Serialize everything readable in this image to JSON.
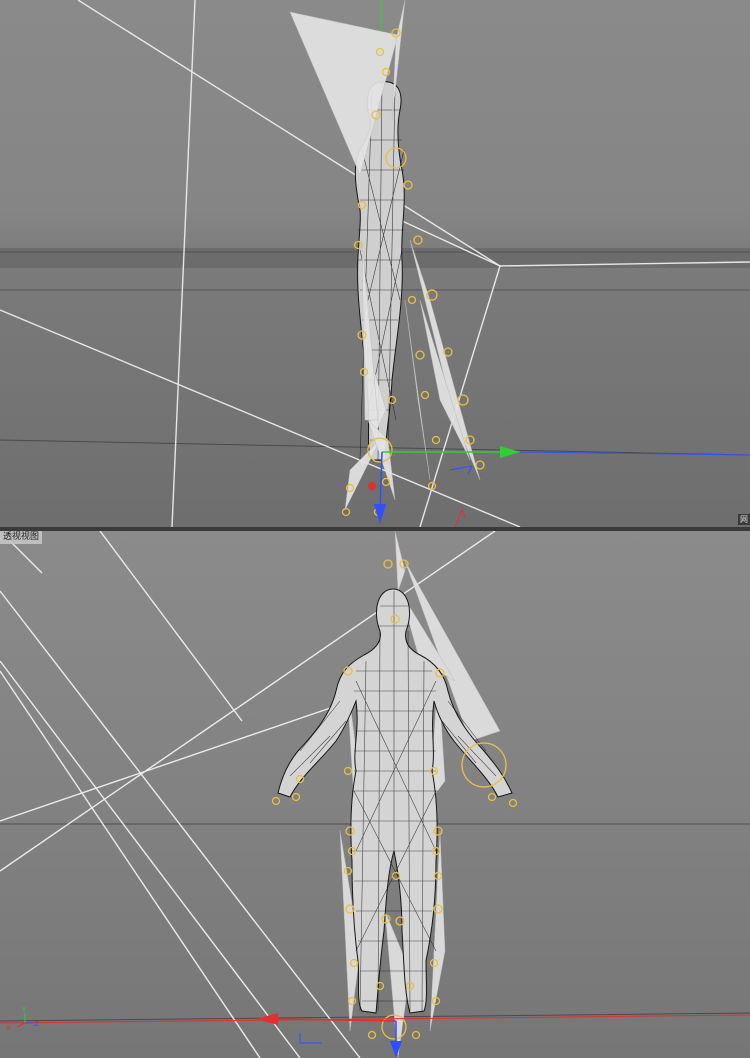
{
  "viewports": {
    "top": {
      "corner_tag": "网"
    },
    "bottom": {
      "label": "透视视图"
    }
  },
  "axis_labels": {
    "x": "X",
    "y": "Y",
    "z": "Z"
  },
  "colors": {
    "axis_x": "#e03030",
    "axis_y": "#30d030",
    "axis_z": "#3050ff",
    "joint": "#e8c040",
    "bone": "#d8d8d8",
    "mesh": "#151515"
  }
}
